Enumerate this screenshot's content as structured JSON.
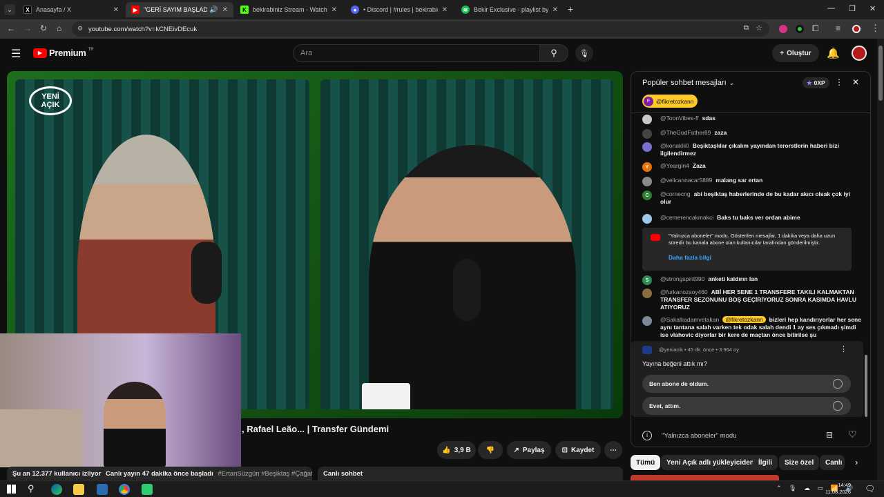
{
  "browser": {
    "tabs": [
      {
        "title": "Anasayfa / X"
      },
      {
        "title": "\"GERİ SAYIM BAŞLADI!\" Du",
        "active": true
      },
      {
        "title": "bekirabiniz Stream - Watch Live"
      },
      {
        "title": "• Discord | #rules | bekirabiniz"
      },
      {
        "title": "Bekir Exclusive - playlist by Bek"
      }
    ],
    "url": "youtube.com/watch?v=kCNEivDEcuk"
  },
  "youtube": {
    "logo": "Premium",
    "logo_region": "TR",
    "search_placeholder": "Ara",
    "create_label": "Oluştur"
  },
  "video": {
    "overlay_logo_line1": "YENİ",
    "overlay_logo_line2": "AÇIK",
    "title_fragment": ", Rafael Leão... | Transfer Gündemi",
    "likes": "3,9 B",
    "share_label": "Paylaş",
    "save_label": "Kaydet"
  },
  "below": {
    "viewers_text": "Şu an 12.377 kullanıcı izliyor",
    "started_text": "Canlı yayın 47 dakika önce başladı",
    "hashtags": "#ErtanSüzgün #Beşiktaş #ÇağatayS",
    "live_chat_label": "Canlı sohbet"
  },
  "chat": {
    "title": "Popüler sohbet mesajları",
    "points": "0XP",
    "pinned_user": "@fikretozkann",
    "pinned_initial": "F",
    "messages": [
      {
        "user": "@ToonVibes-ff",
        "text": "sdas",
        "initial": "",
        "color": "#c8c8c8"
      },
      {
        "user": "@TheGodFather89",
        "text": "zaza",
        "initial": "",
        "color": "#444444"
      },
      {
        "user": "@konaklii0",
        "text": "Beşiktaşlılar çıkalım yayından terorstlerin haberi bizi ilgilendirmez",
        "initial": "",
        "color": "#7a6fd0"
      },
      {
        "user": "@Yeargin4",
        "text": "Zaza",
        "initial": "Y",
        "color": "#e8710a"
      },
      {
        "user": "@velicannacar5889",
        "text": "malang sar ertan",
        "initial": "",
        "color": "#8a8a8a"
      },
      {
        "user": "@cornecng",
        "text": "abi beşiktaş haberlerinde de bu kadar akıcı olsak çok iyi olur",
        "initial": "C",
        "color": "#2e7d32"
      },
      {
        "user": "@cemerencakmakci",
        "text": "Baks tu baks ver ordan abime",
        "initial": "",
        "color": "#9fc8e8"
      }
    ],
    "notice": {
      "text": "\"Yalnızca aboneler\" modu. Gösterilen mesajlar, 1 dakika veya daha uzun süredir bu kanala abone olan kullanıcılar tarafından gönderilmiştir.",
      "link": "Daha fazla bilgi"
    },
    "messages2": [
      {
        "user": "@strongspirit990",
        "text": "anketi kaldırın lan",
        "initial": "S",
        "color": "#2e8b57"
      },
      {
        "user": "@furkanozsoy460",
        "text": "ABİ HER SENE 1 TRANSFERE TAKILI KALMAKTAN TRANSFER SEZONUNU BOŞ GEÇİRİYORUZ SONRA KASIMDA HAVLU ATIYORUZ",
        "initial": "",
        "color": "#8a6d3b"
      },
      {
        "user": "@Sakallıadamvetakan",
        "mention": "@fikretozkann",
        "text": "bizleri hep kandırıyorlar her sene aynı tantana salah varken tek odak salah dendi 1 ay ses çıkmadı şimdi ise vlahovic diyorlar bir kere de maçtan önce bitirilse şu",
        "initial": "",
        "color": "#7a8a9a"
      }
    ],
    "poll": {
      "channel": "@yeniacik",
      "meta": "• 45 dk. önce • 3.964 oy",
      "question": "Yayına beğeni attık mı?",
      "options": [
        "Ben abone de oldum.",
        "Evet, attım."
      ]
    },
    "footer_mode": "\"Yalnızca aboneler\" modu"
  },
  "chips": [
    "Tümü",
    "Yeni Açık adlı yükleyiciden",
    "İlgili",
    "Size özel",
    "Canlı"
  ],
  "taskbar": {
    "time": "14:49",
    "date": "11.08.2026"
  },
  "colors": {
    "accent_red": "#ff0000",
    "brand_green": "#1e8c1e",
    "link_blue": "#3ea6ff",
    "pinned_yellow": "#ffca28"
  }
}
